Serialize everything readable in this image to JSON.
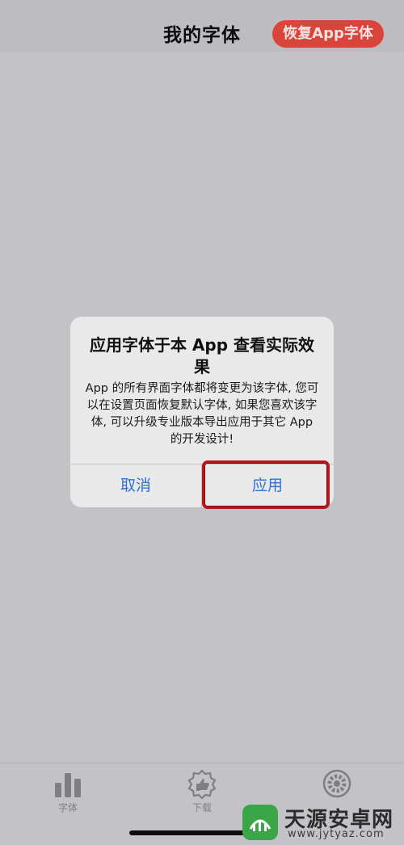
{
  "header": {
    "title": "我的字体",
    "restore_button": "恢复App字体"
  },
  "dialog": {
    "title": "应用字体于本 App 查看实际效果",
    "message": "App 的所有界面字体都将变更为该字体, 您可以在设置页面恢复默认字体, 如果您喜欢该字体, 可以升级专业版本导出应用于其它 App 的开发设计!",
    "cancel_label": "取消",
    "apply_label": "应用"
  },
  "tabbar": {
    "tabs": [
      {
        "label": "字体",
        "icon": "bar-chart-icon"
      },
      {
        "label": "下载",
        "icon": "thumbs-up-badge-icon"
      },
      {
        "label": "",
        "icon": "gear-icon"
      }
    ]
  },
  "watermark": {
    "title": "天源安卓网",
    "url": "www.jytyaz.com"
  },
  "colors": {
    "accent_red": "#d9453b",
    "link_blue": "#2f6fd6",
    "overlay_gray": "#c3c2c7",
    "highlight_red": "#b8141c"
  }
}
